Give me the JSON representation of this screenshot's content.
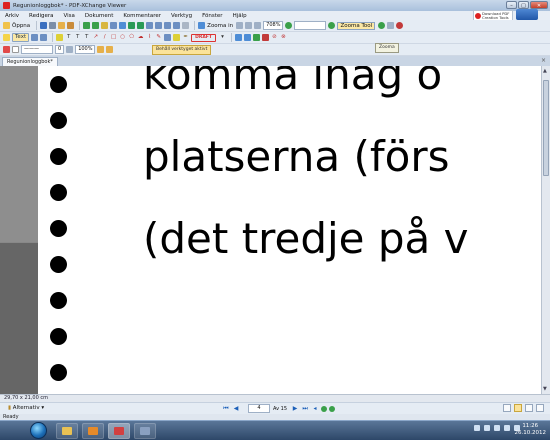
{
  "window": {
    "title": "Regunionloggbok* - PDF-XChange Viewer",
    "app_icon": "pdf-xchange-icon",
    "buttons": {
      "minimize": "–",
      "maximize": "□",
      "close": "✕"
    }
  },
  "brand": {
    "line1": "Download PDF",
    "line2": "Creation Tools"
  },
  "menu": [
    "Arkiv",
    "Redigera",
    "Visa",
    "Dokument",
    "Kommentarer",
    "Verktyg",
    "Fönster",
    "Hjälp"
  ],
  "toolbar1": {
    "open_label": "Öppna",
    "zoom_in_label": "Zooma in",
    "zoom_value": "708%",
    "zoom_tool_label": "Zooma Tool"
  },
  "toolbar2": {
    "text_tool_label": "Text"
  },
  "toolbar3": {
    "line_width": "0",
    "zoom_percent": "100%"
  },
  "stamp_label": "DRAFT",
  "tooltips": {
    "zoom": "Zooma",
    "keep_tool": "Behåll verktyget aktivt"
  },
  "document_tab": {
    "label": "Regunionloggbok*",
    "close": "×"
  },
  "page": {
    "lines": [
      "komma  ihåg  o",
      "platserna (förs",
      "(det tredje på v"
    ],
    "dimensions": "29,70 x 21,00 cm"
  },
  "navigation": {
    "alternatives_label": "Alternativ",
    "current_page": "4",
    "total_pages": "Av 15"
  },
  "status": {
    "text": "Ready"
  },
  "taskbar": {
    "clock_time": "11:26",
    "clock_date": "26.10.2012"
  },
  "colors": {
    "accent": "#1b5fb9",
    "workspace": "#8e8e8e",
    "draft": "#dd3333"
  }
}
